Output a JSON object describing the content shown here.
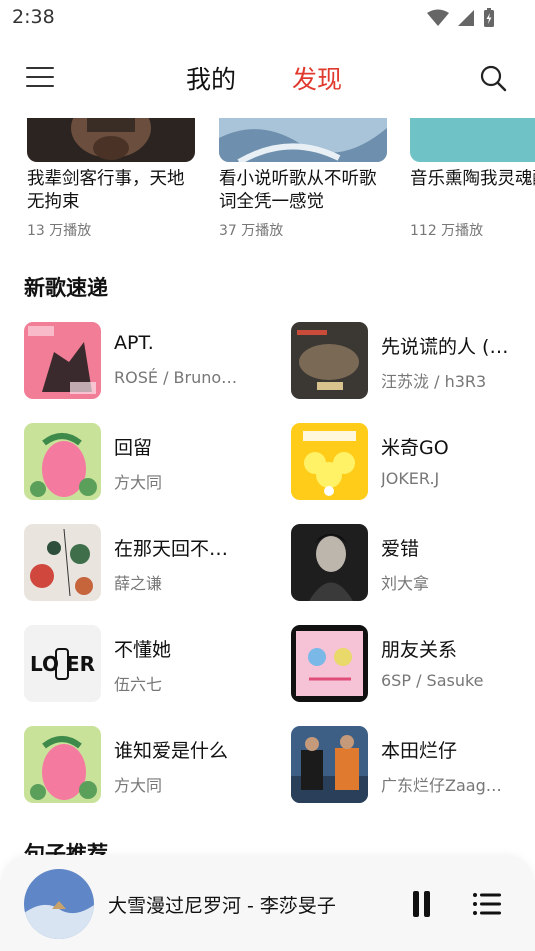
{
  "status_bar": {
    "time": "2:38"
  },
  "header": {
    "tabs": [
      {
        "label": "我的"
      },
      {
        "label": "发现"
      }
    ]
  },
  "playlists": [
    {
      "title": "我辈剑客行事，天地无拘束",
      "plays": "13 万播放"
    },
    {
      "title": "看小说听歌从不听歌词全凭一感觉",
      "plays": "37 万播放"
    },
    {
      "title": "音乐熏陶我灵魂醉了流年",
      "plays": "112 万播放"
    }
  ],
  "new_songs": {
    "title": "新歌速递",
    "items": [
      {
        "title": "APT.",
        "artist": "ROSÉ / Bruno…"
      },
      {
        "title": "先说谎的人 (…",
        "artist": "汪苏泷 / h3R3"
      },
      {
        "title": "回留",
        "artist": "方大同"
      },
      {
        "title": "米奇GO",
        "artist": "JOKER.J"
      },
      {
        "title": "在那天回不…",
        "artist": "薛之谦"
      },
      {
        "title": "爱错",
        "artist": "刘大拿"
      },
      {
        "title": "不懂她",
        "artist": "伍六七"
      },
      {
        "title": "朋友关系",
        "artist": "6SP / Sasuke"
      },
      {
        "title": "谁知爱是什么",
        "artist": "方大同"
      },
      {
        "title": "本田烂仔",
        "artist": "广东烂仔Zaag…"
      }
    ]
  },
  "quotes": {
    "title": "句子推荐"
  },
  "player": {
    "now_playing": "大雪漫过尼罗河 - 李莎旻子"
  },
  "colors": {
    "accent": "#e03a2f"
  }
}
